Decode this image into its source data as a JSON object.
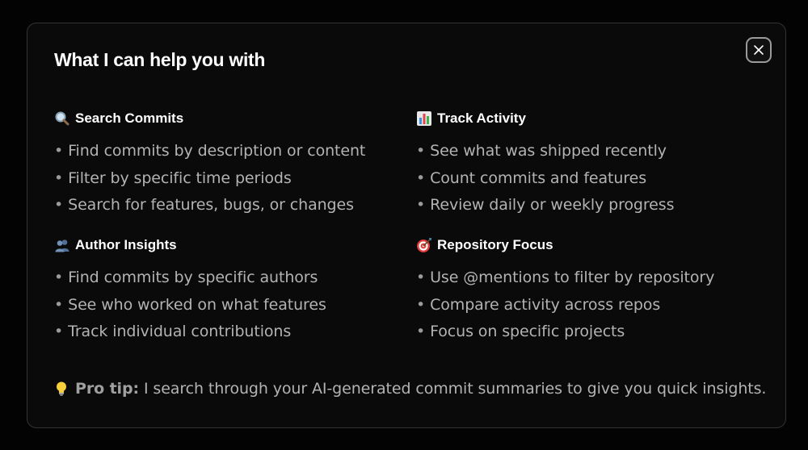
{
  "dialog": {
    "title": "What I can help you with",
    "close_icon": "close-icon"
  },
  "sections": [
    {
      "icon": "magnifier-icon",
      "heading": "Search Commits",
      "items": [
        "Find commits by description or content",
        "Filter by specific time periods",
        "Search for features, bugs, or changes"
      ]
    },
    {
      "icon": "bar-chart-icon",
      "heading": "Track Activity",
      "items": [
        "See what was shipped recently",
        "Count commits and features",
        "Review daily or weekly progress"
      ]
    },
    {
      "icon": "people-icon",
      "heading": "Author Insights",
      "items": [
        "Find commits by specific authors",
        "See who worked on what features",
        "Track individual contributions"
      ]
    },
    {
      "icon": "target-icon",
      "heading": "Repository Focus",
      "items": [
        "Use @mentions to filter by repository",
        "Compare activity across repos",
        "Focus on specific projects"
      ]
    }
  ],
  "bullet": "•",
  "tip": {
    "icon": "lightbulb-icon",
    "label": "Pro tip:",
    "text": "I search through your AI-generated commit summaries to give you quick insights."
  }
}
